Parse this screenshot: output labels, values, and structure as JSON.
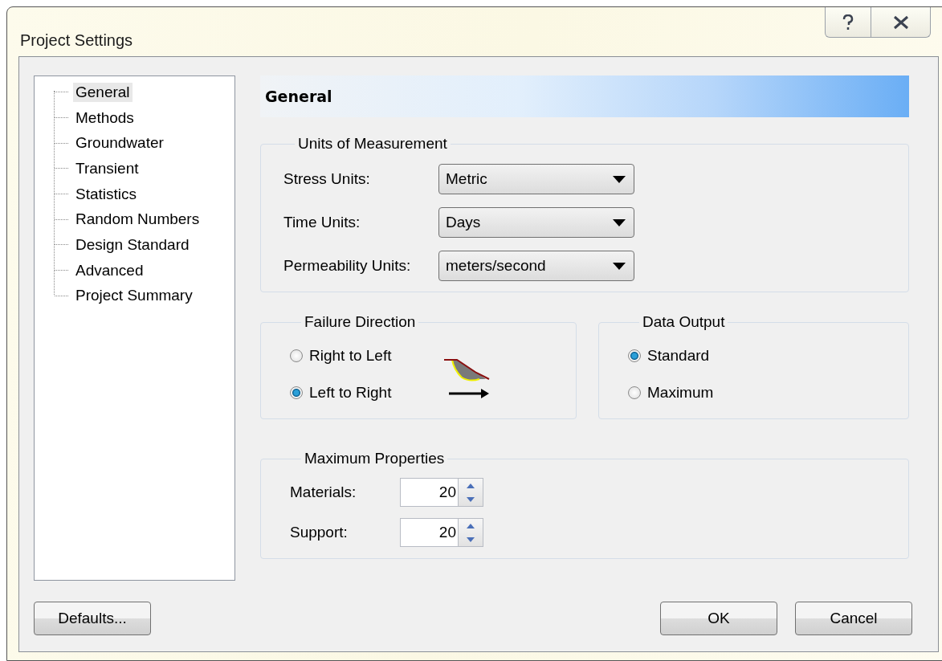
{
  "window": {
    "title": "Project Settings"
  },
  "tree": {
    "items": [
      {
        "label": "General",
        "selected": true
      },
      {
        "label": "Methods",
        "selected": false
      },
      {
        "label": "Groundwater",
        "selected": false
      },
      {
        "label": "Transient",
        "selected": false
      },
      {
        "label": "Statistics",
        "selected": false
      },
      {
        "label": "Random Numbers",
        "selected": false
      },
      {
        "label": "Design Standard",
        "selected": false
      },
      {
        "label": "Advanced",
        "selected": false
      },
      {
        "label": "Project Summary",
        "selected": false
      }
    ]
  },
  "page_title": "General",
  "units": {
    "title": "Units of Measurement",
    "fields": [
      {
        "label": "Stress Units:",
        "value": "Metric"
      },
      {
        "label": "Time Units:",
        "value": "Days"
      },
      {
        "label": "Permeability Units:",
        "value": "meters/second"
      }
    ]
  },
  "failure_direction": {
    "title": "Failure Direction",
    "options": [
      {
        "label": "Right to Left",
        "selected": false
      },
      {
        "label": "Left to Right",
        "selected": true
      }
    ]
  },
  "data_output": {
    "title": "Data Output",
    "options": [
      {
        "label": "Standard",
        "selected": true
      },
      {
        "label": "Maximum",
        "selected": false
      }
    ]
  },
  "maximum_properties": {
    "title": "Maximum Properties",
    "fields": [
      {
        "label": "Materials:",
        "value": "20"
      },
      {
        "label": "Support:",
        "value": "20"
      }
    ]
  },
  "buttons": {
    "defaults": "Defaults...",
    "ok": "OK",
    "cancel": "Cancel"
  }
}
